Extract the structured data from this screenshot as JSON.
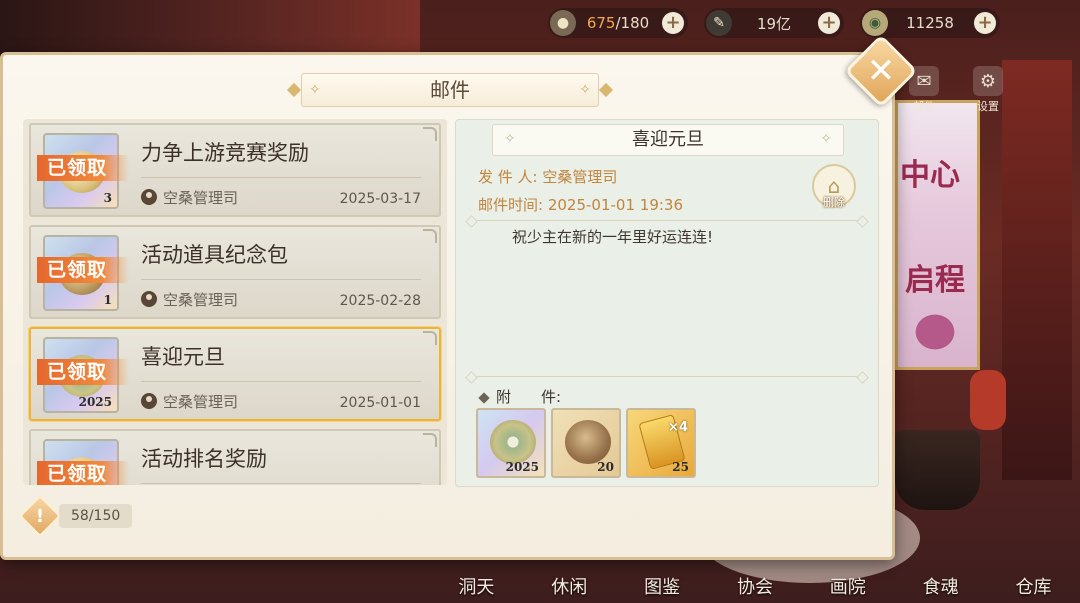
{
  "resources": [
    {
      "icon": "stamina-icon",
      "value_highlight": "675",
      "value_rest": "/180"
    },
    {
      "icon": "quill-icon",
      "value_highlight": "",
      "value_rest": "19亿"
    },
    {
      "icon": "coin-icon",
      "value_highlight": "",
      "value_rest": "11258"
    }
  ],
  "topnav": [
    {
      "label": "邮件"
    },
    {
      "label": "设置"
    }
  ],
  "background": {
    "poster_line1": "中心",
    "poster_line2": "启程"
  },
  "bottomnav": [
    "洞天",
    "休闲",
    "图鉴",
    "协会",
    "画院",
    "食魂",
    "仓库"
  ],
  "dialog": {
    "title": "邮件",
    "close": "✕"
  },
  "mails": [
    {
      "title": "力争上游竞赛奖励",
      "claimed": "已领取",
      "sender": "空桑管理司",
      "date": "2025-03-17",
      "count": "3",
      "thumb": "gem"
    },
    {
      "title": "活动道具纪念包",
      "claimed": "已领取",
      "sender": "空桑管理司",
      "date": "2025-02-28",
      "count": "1",
      "thumb": "bag"
    },
    {
      "title": "喜迎元旦",
      "claimed": "已领取",
      "sender": "空桑管理司",
      "date": "2025-01-01",
      "count": "2025",
      "thumb": "jade",
      "selected": true
    },
    {
      "title": "活动排名奖励",
      "claimed": "已领取",
      "sender": "",
      "date": "",
      "count": "",
      "thumb": "gem"
    }
  ],
  "mail_count": "58/150",
  "detail": {
    "title": "喜迎元旦",
    "sender_label": "发 件 人:",
    "sender": "空桑管理司",
    "time_label": "邮件时间:",
    "time": "2025-01-01 19:36",
    "body": "祝少主在新的一年里好运连连!",
    "delete_label": "删除",
    "attachments_label": "附　　件:",
    "attachments": [
      {
        "name": "jade-ring-icon",
        "count": "2025",
        "multiplier": ""
      },
      {
        "name": "cloth-bag-icon",
        "count": "20",
        "multiplier": ""
      },
      {
        "name": "gold-ticket-icon",
        "count": "25",
        "multiplier": "×4"
      }
    ]
  }
}
